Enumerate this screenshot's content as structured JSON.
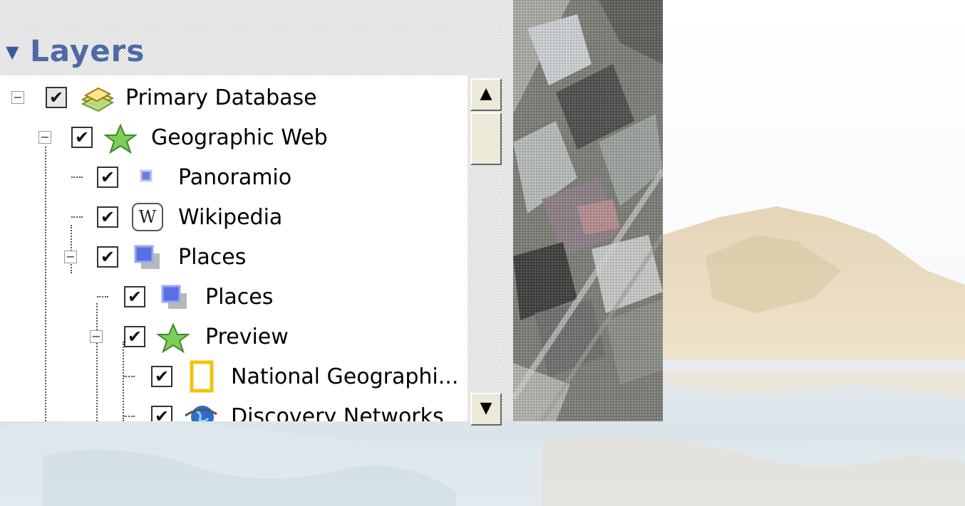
{
  "panel": {
    "title": "Layers"
  },
  "tree": [
    {
      "label": "Primary Database",
      "icon": "database-icon",
      "level": 0,
      "checked": true,
      "expander": "minus"
    },
    {
      "label": "Geographic Web",
      "icon": "star-icon",
      "level": 1,
      "checked": true,
      "expander": "minus"
    },
    {
      "label": "Panoramio",
      "icon": "square-icon",
      "level": 2,
      "checked": true
    },
    {
      "label": "Wikipedia",
      "icon": "wikipedia-icon",
      "level": 2,
      "checked": true
    },
    {
      "label": "Places",
      "icon": "places-icon",
      "level": 2,
      "checked": true,
      "expander": "minus"
    },
    {
      "label": "Places",
      "icon": "places-icon",
      "level": 3,
      "checked": true
    },
    {
      "label": "Preview",
      "icon": "star-icon",
      "level": 3,
      "checked": true,
      "expander": "minus"
    },
    {
      "label": "National Geographi...",
      "icon": "natgeo-icon",
      "level": 4,
      "checked": true
    },
    {
      "label": "Discovery Networks",
      "icon": "globe-icon",
      "level": 4,
      "checked": true
    }
  ],
  "scrollbar": {
    "up_glyph": "▲",
    "down_glyph": "▼"
  },
  "colors": {
    "header_text": "#4d6aa6",
    "accent": "#3a5a9c"
  }
}
